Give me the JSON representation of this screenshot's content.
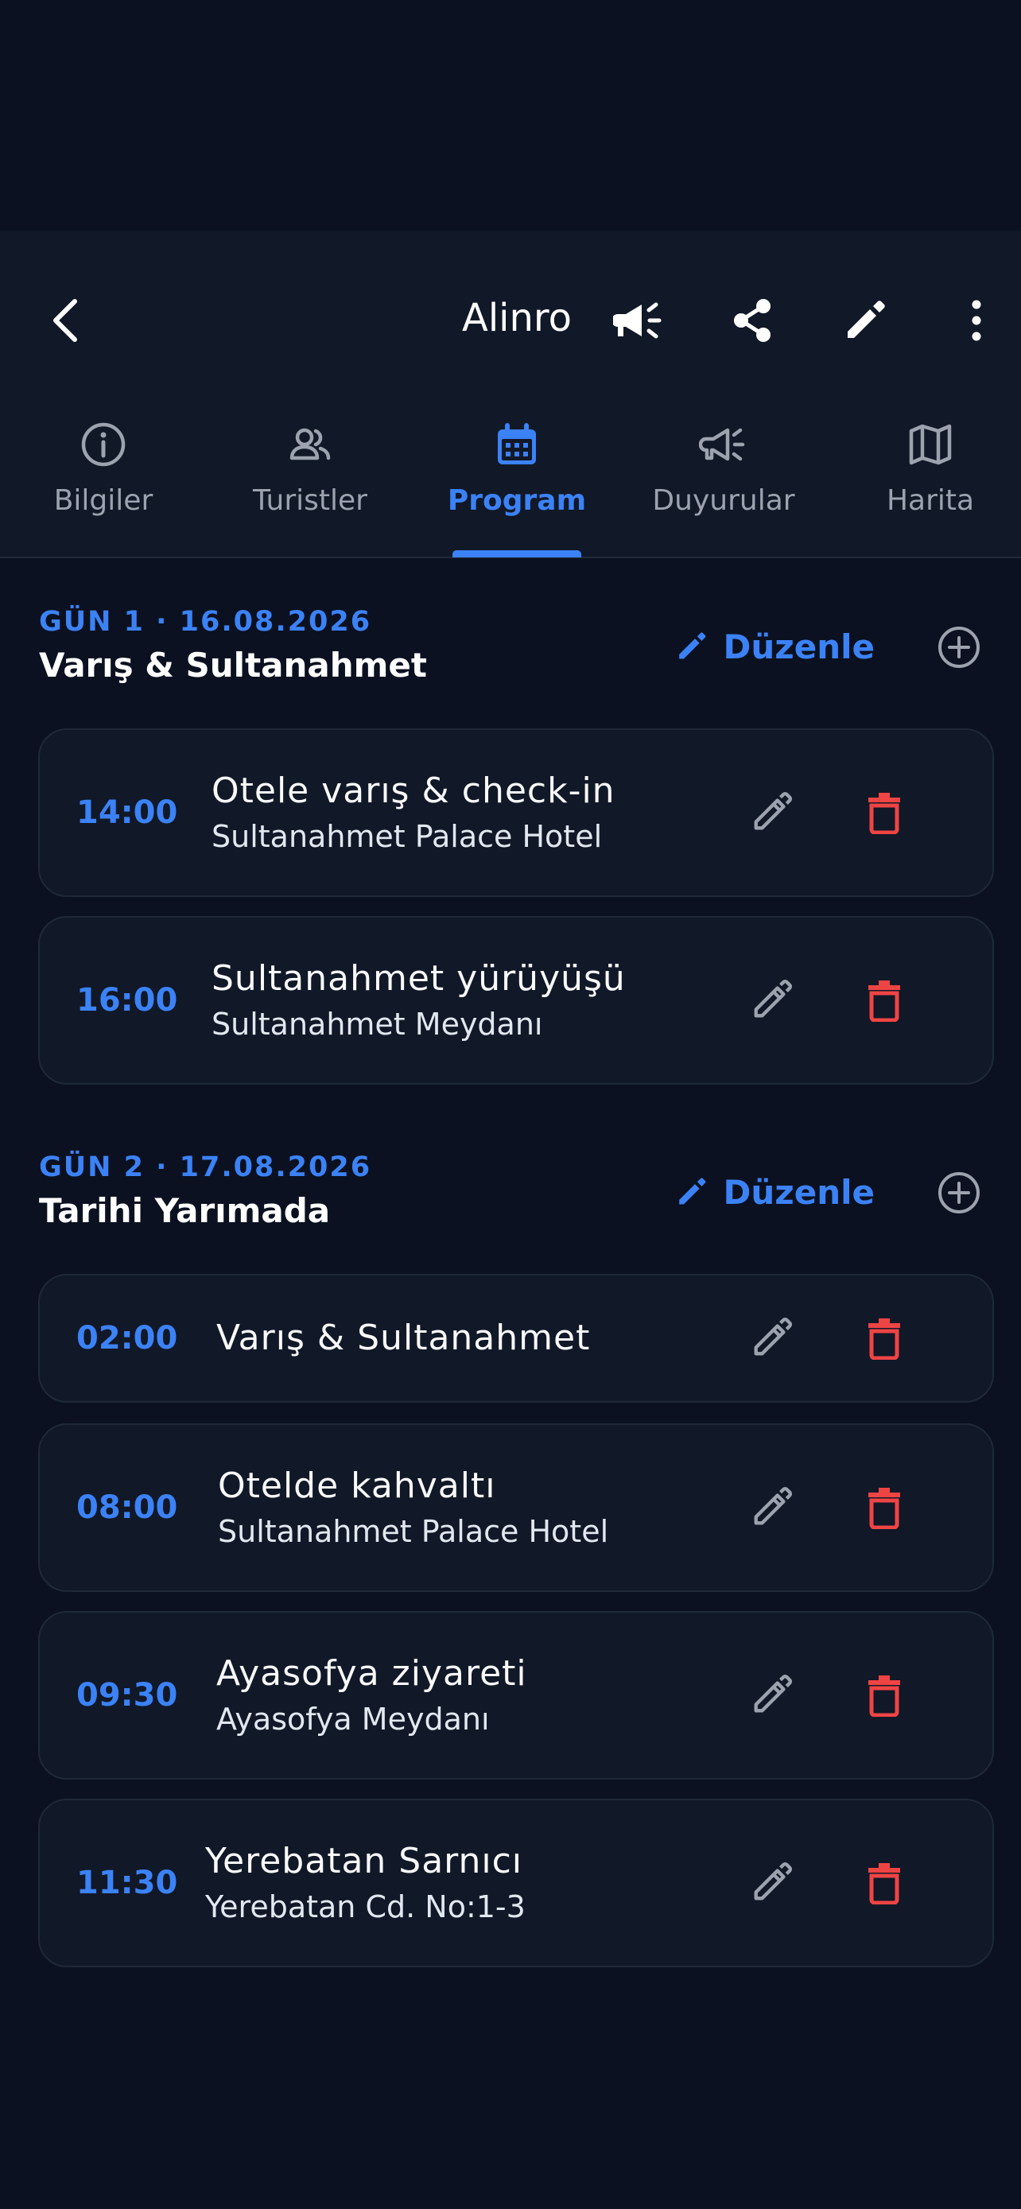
{
  "header": {
    "title": "Alinro",
    "icons": {
      "back": "back-arrow-icon",
      "announce": "megaphone-icon",
      "share": "share-icon",
      "edit": "pencil-icon",
      "more": "more-vertical-icon"
    }
  },
  "tabs": [
    {
      "label": "Bilgiler",
      "icon": "info-icon",
      "active": false
    },
    {
      "label": "Turistler",
      "icon": "people-icon",
      "active": false
    },
    {
      "label": "Program",
      "icon": "calendar-icon",
      "active": true
    },
    {
      "label": "Duyurular",
      "icon": "megaphone-icon",
      "active": false
    },
    {
      "label": "Harita",
      "icon": "map-icon",
      "active": false
    }
  ],
  "days": [
    {
      "label": "GÜN 1 · 16.08.2026",
      "title": "Varış & Sultanahmet",
      "edit_label": "Düzenle",
      "events": [
        {
          "time": "14:00",
          "title": "Otele varış & check-in",
          "place": "Sultanahmet Palace Hotel"
        },
        {
          "time": "16:00",
          "title": "Sultanahmet yürüyüşü",
          "place": "Sultanahmet Meydanı"
        }
      ]
    },
    {
      "label": "GÜN 2 · 17.08.2026",
      "title": "Tarihi Yarımada",
      "edit_label": "Düzenle",
      "events": [
        {
          "time": "02:00",
          "title": "Varış & Sultanahmet",
          "place": ""
        },
        {
          "time": "08:00",
          "title": "Otelde kahvaltı",
          "place": "Sultanahmet Palace Hotel"
        },
        {
          "time": "09:30",
          "title": "Ayasofya ziyareti",
          "place": "Ayasofya Meydanı"
        },
        {
          "time": "11:30",
          "title": "Yerebatan Sarnıcı",
          "place": "Yerebatan Cd. No:1-3"
        }
      ]
    }
  ],
  "colors": {
    "background": "#0b1120",
    "card": "#111827",
    "accent": "#3b82f6",
    "delete": "#ef4444",
    "muted_icon": "#9ca3af"
  }
}
